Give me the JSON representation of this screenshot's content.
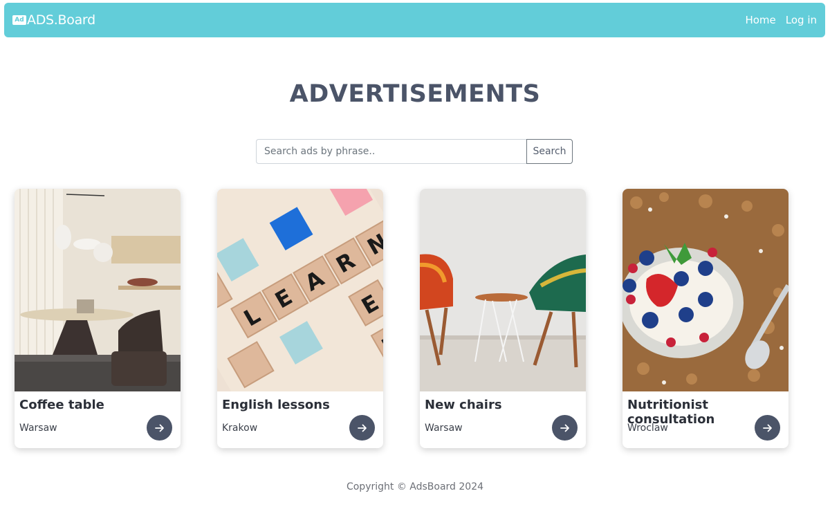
{
  "navbar": {
    "brand_logo": "Ad",
    "brand_text": "ADS.Board",
    "links": [
      {
        "label": "Home"
      },
      {
        "label": "Log in"
      }
    ]
  },
  "page_title": "ADVERTISEMENTS",
  "search": {
    "placeholder": "Search ads by phrase..",
    "value": "",
    "button_label": "Search"
  },
  "ads": [
    {
      "title": "Coffee table",
      "city": "Warsaw",
      "image": "living-room-coffee-table-photo"
    },
    {
      "title": "English lessons",
      "city": "Krakow",
      "image": "scrabble-tiles-learn-photo"
    },
    {
      "title": "New chairs",
      "city": "Warsaw",
      "image": "patterned-chairs-side-table-photo"
    },
    {
      "title": "Nutritionist consultation",
      "city": "Wroclaw",
      "image": "granola-berries-bowl-photo"
    }
  ],
  "footer": "Copyright © AdsBoard 2024",
  "colors": {
    "navbar": "#62cdd9",
    "title": "#4b5468",
    "arrow_button": "#4b5468"
  },
  "icons": {
    "card_button": "arrow-right-icon",
    "brand": "ad-logo-icon"
  }
}
